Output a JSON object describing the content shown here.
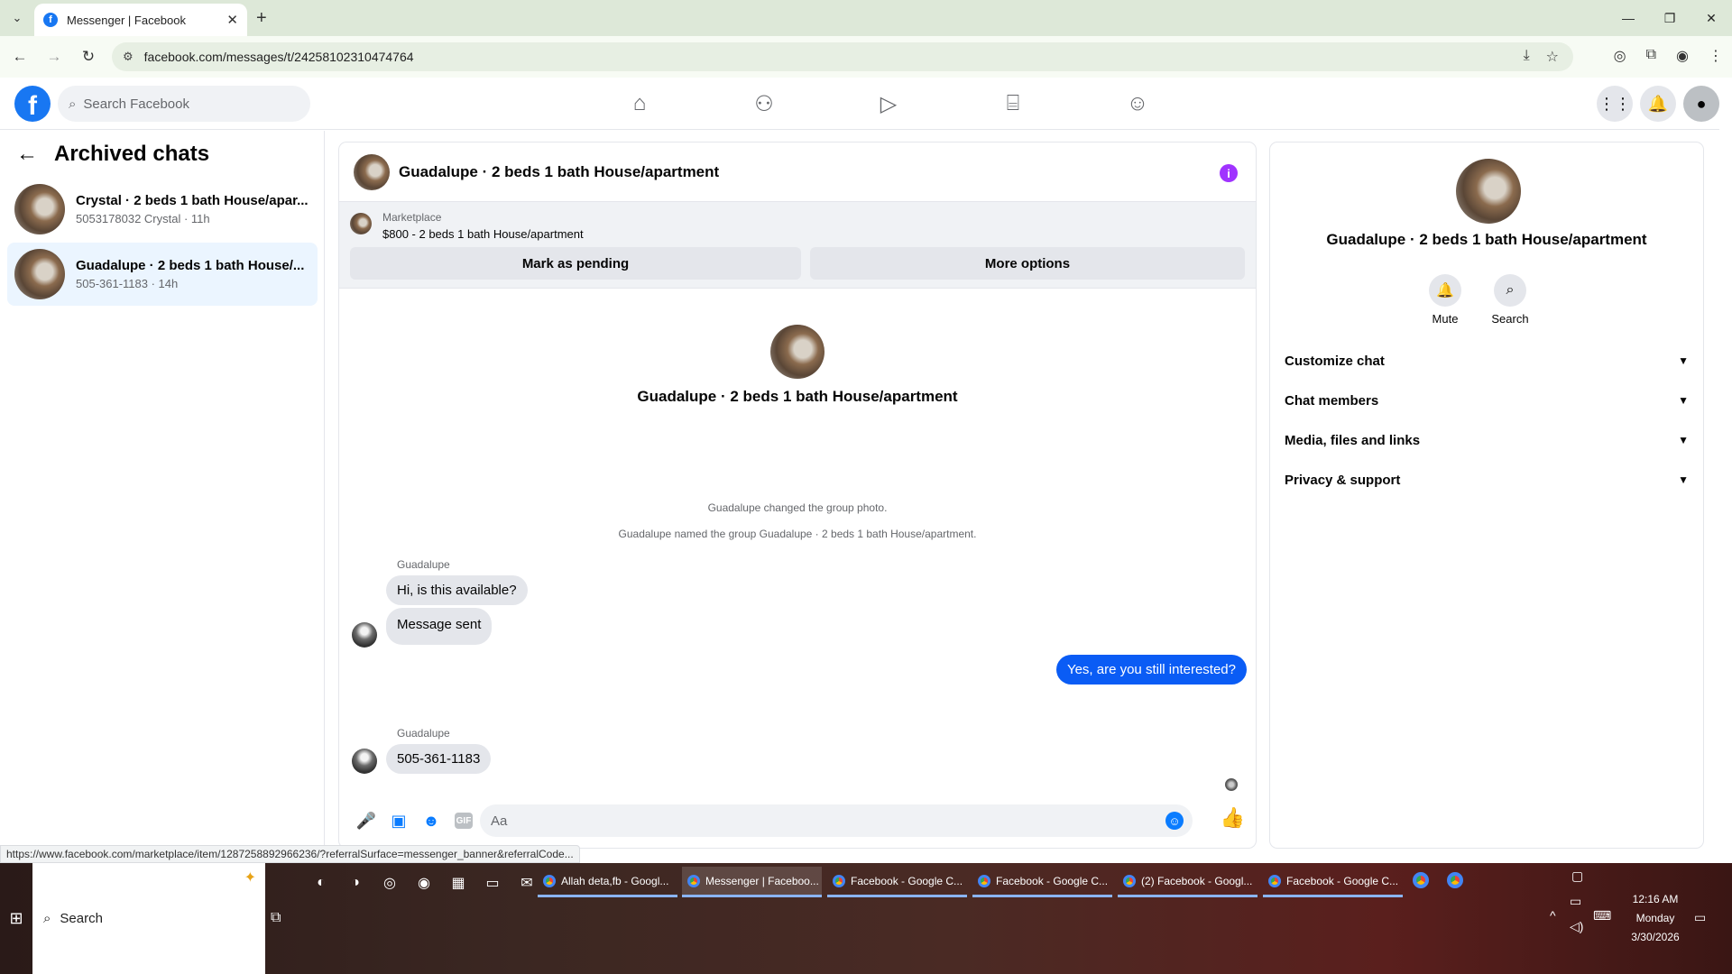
{
  "browser": {
    "tab_title": "Messenger | Facebook",
    "url": "facebook.com/messages/t/24258102310474764",
    "status_url": "https://www.facebook.com/marketplace/item/1287258892966236/?referralSurface=messenger_banner&referralCode..."
  },
  "fb": {
    "search_placeholder": "Search Facebook"
  },
  "left": {
    "title": "Archived chats",
    "chats": [
      {
        "name": "Crystal · 2 beds 1 bath House/apar...",
        "sub": "5053178032 Crystal · 11h"
      },
      {
        "name": "Guadalupe · 2 beds 1 bath House/...",
        "sub": "505-361-1183 · 14h"
      }
    ]
  },
  "conversation": {
    "title": "Guadalupe · 2 beds 1 bath House/apartment",
    "marketplace_label": "Marketplace",
    "listing": "$800 - 2 beds 1 bath House/apartment",
    "mark_pending": "Mark as pending",
    "more_options": "More options",
    "center_title": "Guadalupe · 2 beds 1 bath House/apartment",
    "system1": "Guadalupe changed the group photo.",
    "system2": "Guadalupe named the group Guadalupe · 2 beds 1 bath House/apartment.",
    "sender1": "Guadalupe",
    "msg1": "Hi, is this available?",
    "msg2": "Message sent",
    "my_msg": "Yes, are you still interested?",
    "sender2": "Guadalupe",
    "msg3": "505-361-1183",
    "input_placeholder": "Aa"
  },
  "details": {
    "title": "Guadalupe · 2 beds 1 bath House/apartment",
    "mute": "Mute",
    "search": "Search",
    "sections": [
      "Customize chat",
      "Chat members",
      "Media, files and links",
      "Privacy & support"
    ]
  },
  "taskbar": {
    "search": "Search",
    "windows": [
      "Allah deta,fb - Googl...",
      "Messenger | Faceboo...",
      "Facebook - Google C...",
      "Facebook - Google C...",
      "(2) Facebook - Googl...",
      "Facebook - Google C..."
    ],
    "time": "12:16 AM",
    "day": "Monday",
    "date": "3/30/2026"
  },
  "colors": {
    "fb_blue": "#1877f2",
    "my_bubble": "#0a5cf5",
    "info_purple": "#a033ff",
    "active_chat": "#ebf5ff"
  }
}
